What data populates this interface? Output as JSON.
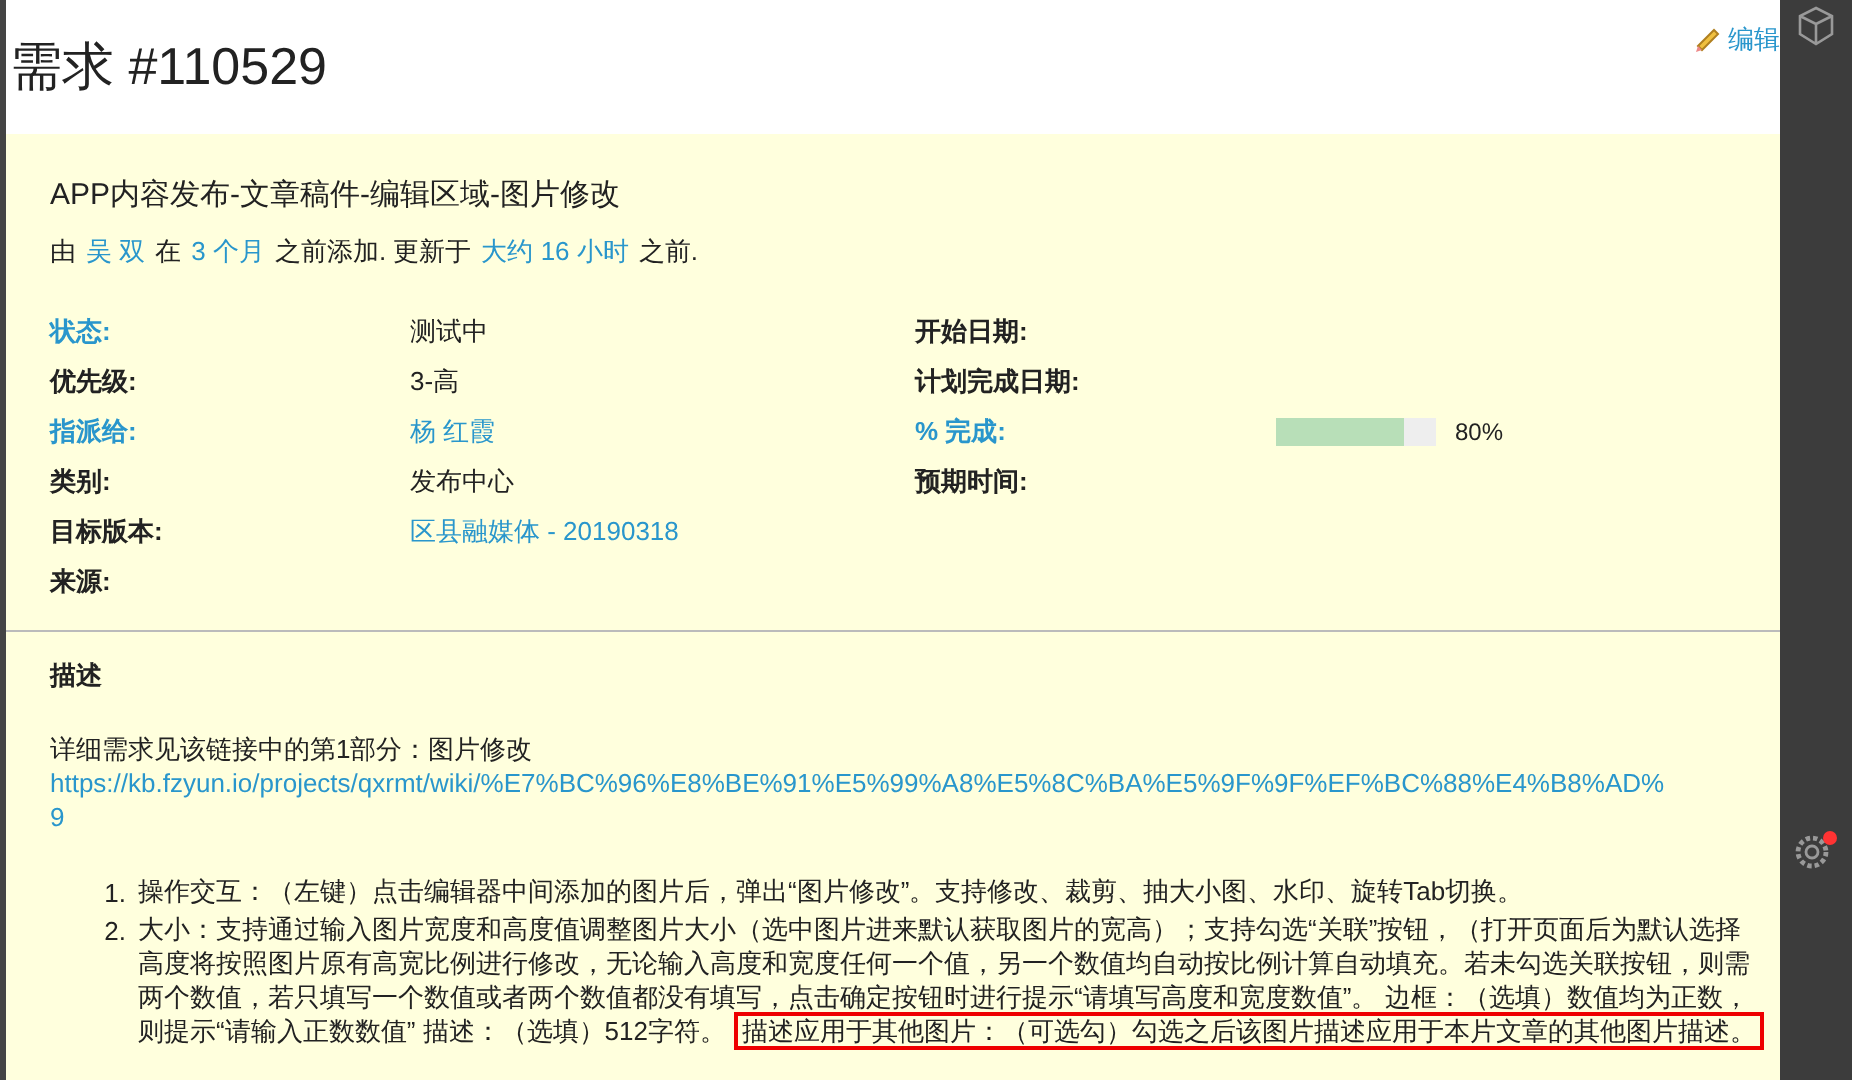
{
  "header": {
    "title": "需求 #110529",
    "edit_link": "编辑"
  },
  "issue": {
    "subject": "APP内容发布-文章稿件-编辑区域-图片修改",
    "byline": [
      {
        "kind": "text",
        "text": "由"
      },
      {
        "kind": "link",
        "text": "吴 双"
      },
      {
        "kind": "text",
        "text": "在"
      },
      {
        "kind": "link",
        "text": "3 个月"
      },
      {
        "kind": "text",
        "text": "之前添加. 更新于"
      },
      {
        "kind": "link",
        "text": "大约 16 小时"
      },
      {
        "kind": "text",
        "text": "之前."
      }
    ],
    "attributes_left": [
      {
        "label": "状态:",
        "label_link": true,
        "kind": "text",
        "value": "测试中"
      },
      {
        "label": "优先级:",
        "label_link": false,
        "kind": "text",
        "value": "3-高"
      },
      {
        "label": "指派给:",
        "label_link": true,
        "kind": "link",
        "value": "杨 红霞"
      },
      {
        "label": "类别:",
        "label_link": false,
        "kind": "text",
        "value": "发布中心"
      },
      {
        "label": "目标版本:",
        "label_link": false,
        "kind": "link",
        "value": "区县融媒体 - 20190318"
      },
      {
        "label": "来源:",
        "label_link": false,
        "kind": "empty"
      }
    ],
    "attributes_right": [
      {
        "label": "开始日期:",
        "label_link": false,
        "kind": "empty"
      },
      {
        "label": "计划完成日期:",
        "label_link": false,
        "kind": "empty"
      },
      {
        "label": "% 完成:",
        "label_link": true,
        "kind": "progress",
        "level": 0.8,
        "value": "80%"
      },
      {
        "label": "预期时间:",
        "label_link": false,
        "kind": "empty"
      }
    ],
    "description": {
      "heading": "描述",
      "intro": "详细需求见该链接中的第1部分：图片修改",
      "url_lines": [
        "https://kb.fzyun.io/projects/qxrmt/wiki/%E7%BC%96%E8%BE%91%E5%99%A8%E5%8C%BA%E5%9F%9F%EF%BC%88%E4%B8%AD%",
        "9"
      ],
      "items": [
        {
          "number": "1.",
          "lines": [
            {
              "text": "操作交互：（左键）点击编辑器中间添加的图片后，弹出“图片修改”。支持修改、裁剪、抽大小图、水印、旋转Tab切换。"
            }
          ]
        },
        {
          "number": "2.",
          "lines": [
            {
              "text": "大小：支持通过输入图片宽度和高度值调整图片大小（选中图片进来默认获取图片的宽高）；支持勾选“关联”按钮，（打开页面后为默认选择"
            },
            {
              "text": "高度将按照图片原有高宽比例进行修改，无论输入高度和宽度任何一个值，另一个数值均自动按比例计算自动填充。若未勾选关联按钮，则需"
            },
            {
              "text": "两个数值，若只填写一个数值或者两个数值都没有填写，点击确定按钮时进行提示“请填写高度和宽度数值”。 边框：（选填）数值均为正数，"
            },
            {
              "text": "则提示“请输入正数数值” 描述：（选填）512字符。",
              "highlight": "描述应用于其他图片：（可选勾）勾选之后该图片描述应用于本片文章的其他图片描述。"
            }
          ]
        }
      ]
    }
  },
  "sidebar": {
    "notification": true
  }
}
